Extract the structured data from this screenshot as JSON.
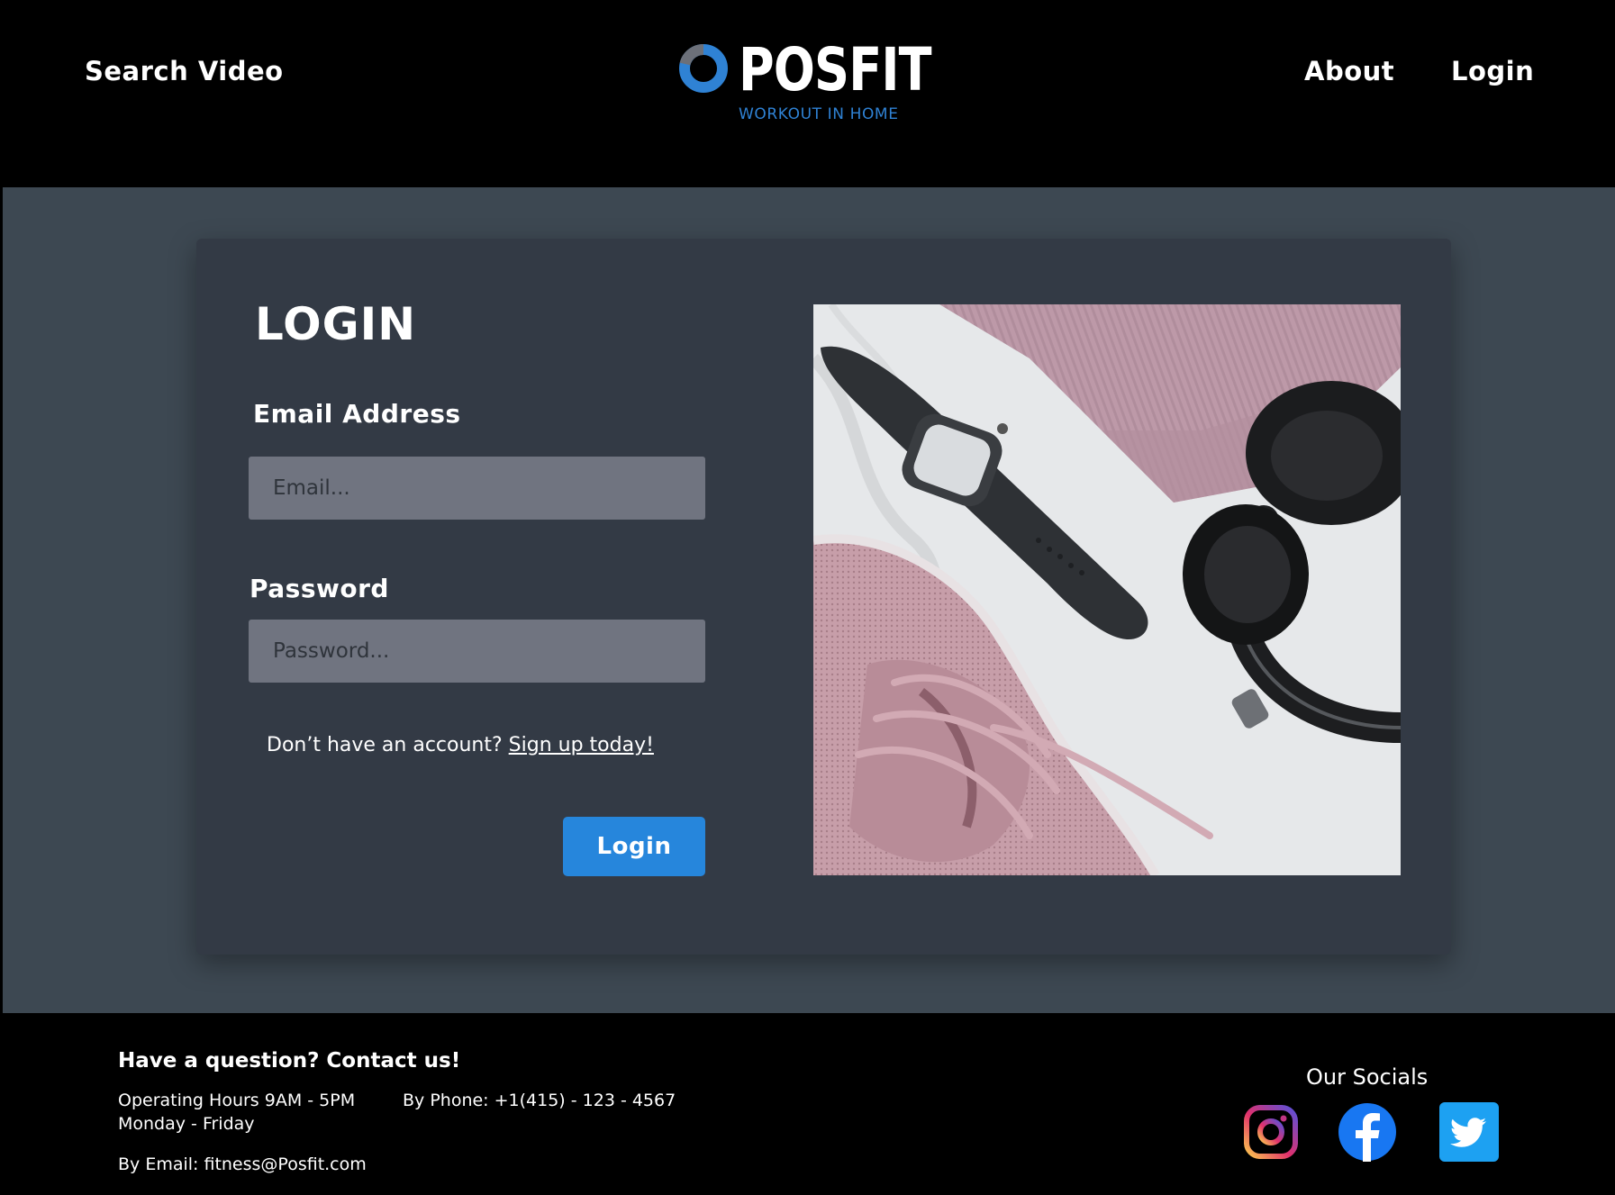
{
  "header": {
    "search_label": "Search Video",
    "logo_text": "POSFIT",
    "logo_tagline": "WORKOUT IN HOME",
    "about_label": "About",
    "login_label": "Login"
  },
  "login_card": {
    "title": "LOGIN",
    "email_label": "Email Address",
    "email_placeholder": "Email...",
    "email_value": "",
    "password_label": "Password",
    "password_placeholder": "Password...",
    "password_value": "",
    "signup_prompt": "Don’t have an account?",
    "signup_link": "Sign up today!",
    "submit_label": "Login"
  },
  "footer": {
    "contact_title": "Have a question? Contact us!",
    "hours": "Operating Hours 9AM - 5PM",
    "days": "Monday - Friday",
    "phone": "By Phone: +1(415) - 123 - 4567",
    "email": "By Email: fitness@Posfit.com",
    "socials_title": "Our Socials",
    "social_icons": [
      "instagram-icon",
      "facebook-icon",
      "twitter-icon"
    ]
  },
  "colors": {
    "accent": "#2686dc",
    "header_bg": "#000000",
    "main_bg": "#3d4852",
    "card_bg": "#333a45",
    "input_bg": "#707480"
  }
}
